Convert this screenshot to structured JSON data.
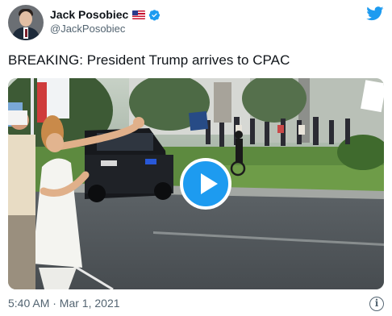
{
  "tweet": {
    "author": {
      "display_name": "Jack Posobiec",
      "handle": "@JackPosobiec",
      "flag_icon": "us-flag-icon",
      "verified_icon": "verified-badge-icon"
    },
    "text": "BREAKING: President Trump arrives to CPAC",
    "media": {
      "type": "video",
      "play_icon": "play-icon"
    },
    "timestamp": "5:40 AM · Mar 1, 2021",
    "info_icon_glyph": "i"
  },
  "colors": {
    "twitter_blue": "#1d9bf0",
    "text_primary": "#0f1419",
    "text_secondary": "#536471"
  }
}
